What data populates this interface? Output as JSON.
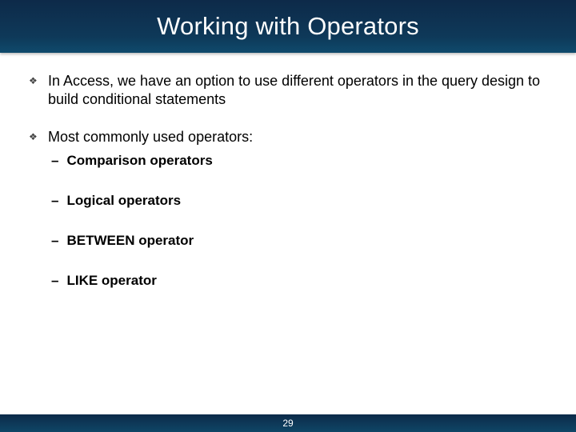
{
  "title": "Working with Operators",
  "bullets": [
    {
      "text": "In Access, we have an option to use different operators in the query design to build conditional statements",
      "subitems": []
    },
    {
      "text": "Most commonly used operators:",
      "subitems": [
        "Comparison operators",
        "Logical operators",
        "BETWEEN operator",
        "LIKE operator"
      ]
    }
  ],
  "page_number": "29",
  "glyphs": {
    "diamond": "❖",
    "dash": "–"
  }
}
